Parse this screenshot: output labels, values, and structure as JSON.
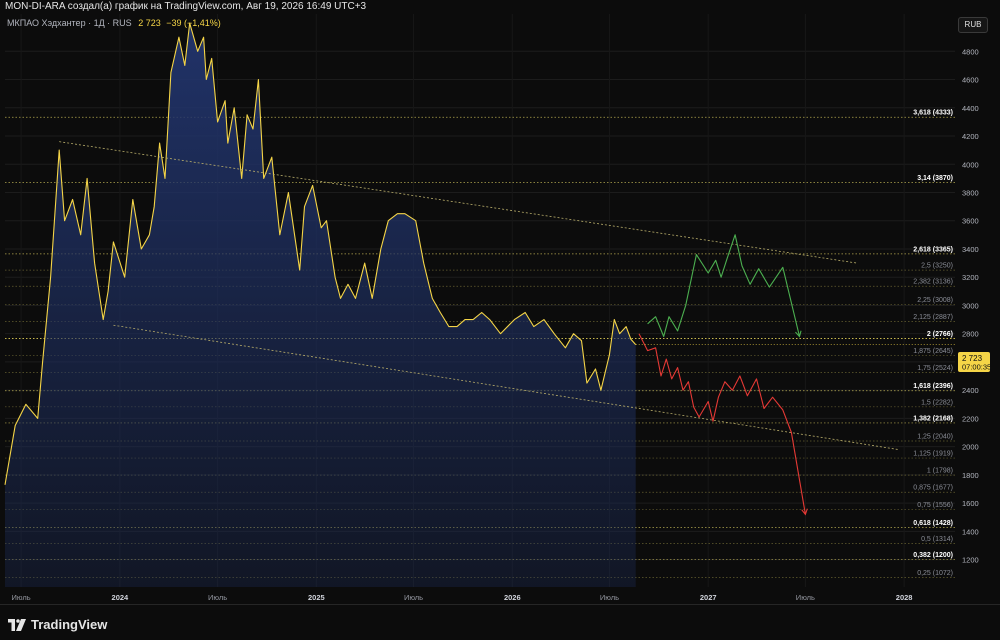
{
  "header": {
    "attribution": "MON-DI-ARA создал(а) график на TradingView.com, Авг 19, 2026 16:49 UTC+3"
  },
  "legend": {
    "symbol": "МКПАО Хэдхантер · 1Д · RUS",
    "price": "2 723",
    "change": "−39 (−1,41%)"
  },
  "currency_button": "RUB",
  "last_price_label": {
    "price": "2 723",
    "countdown": "07:00:35"
  },
  "footer": {
    "logo_text": "TradingView"
  },
  "colors": {
    "price_line": "#f5d547",
    "area_fill": "#1b2a55",
    "bullish_projection": "#4caf50",
    "bearish_projection": "#e53935",
    "fib_line": "#cfc25a",
    "channel_line": "#b8ad6a"
  },
  "chart_data": {
    "type": "area",
    "title": "МКПАО Хэдхантер",
    "x_ticks": [
      "Июль",
      "2024",
      "Июль",
      "2025",
      "Июль",
      "2026",
      "Июль",
      "2027",
      "Июль",
      "2028"
    ],
    "y_ticks": [
      1200,
      1400,
      1600,
      1800,
      2000,
      2200,
      2400,
      2600,
      2800,
      3000,
      3200,
      3400,
      3600,
      3800,
      4000,
      4200,
      4400,
      4600,
      4800
    ],
    "ylim": [
      1020,
      5050
    ],
    "grid": true,
    "fib_levels": [
      {
        "label": "3,618 (4333)",
        "value": 4333,
        "bold": true
      },
      {
        "label": "3,14 (3870)",
        "value": 3870,
        "bold": true
      },
      {
        "label": "2,618 (3365)",
        "value": 3365,
        "bold": true
      },
      {
        "label": "2,5 (3250)",
        "value": 3250,
        "bold": false
      },
      {
        "label": "2,382 (3136)",
        "value": 3136,
        "bold": false
      },
      {
        "label": "2,25 (3008)",
        "value": 3008,
        "bold": false
      },
      {
        "label": "2,125 (2887)",
        "value": 2887,
        "bold": false
      },
      {
        "label": "2 (2766)",
        "value": 2766,
        "bold": true,
        "highlight": true
      },
      {
        "label": "1,875 (2645)",
        "value": 2645,
        "bold": false
      },
      {
        "label": "1,75 (2524)",
        "value": 2524,
        "bold": false
      },
      {
        "label": "1,618 (2396)",
        "value": 2396,
        "bold": true
      },
      {
        "label": "1,5 (2282)",
        "value": 2282,
        "bold": false
      },
      {
        "label": "1,382 (2168)",
        "value": 2168,
        "bold": true
      },
      {
        "label": "1,25 (2040)",
        "value": 2040,
        "bold": false
      },
      {
        "label": "1,125 (1919)",
        "value": 1919,
        "bold": false
      },
      {
        "label": "1 (1798)",
        "value": 1798,
        "bold": false
      },
      {
        "label": "0,875 (1677)",
        "value": 1677,
        "bold": false
      },
      {
        "label": "0,75 (1556)",
        "value": 1556,
        "bold": false
      },
      {
        "label": "0,618 (1428)",
        "value": 1428,
        "bold": true
      },
      {
        "label": "0,5 (1314)",
        "value": 1314,
        "bold": false
      },
      {
        "label": "0,382 (1200)",
        "value": 1200,
        "bold": true
      },
      {
        "label": "0,25 (1072)",
        "value": 1072,
        "bold": false
      }
    ],
    "price_series": {
      "name": "МКПАО Хэдхантер",
      "x": [
        "2023-06-01",
        "2023-06-20",
        "2023-07-10",
        "2023-08-01",
        "2023-08-10",
        "2023-08-25",
        "2023-09-10",
        "2023-09-20",
        "2023-10-05",
        "2023-10-20",
        "2023-11-01",
        "2023-11-15",
        "2023-12-01",
        "2023-12-10",
        "2023-12-20",
        "2024-01-10",
        "2024-01-25",
        "2024-02-10",
        "2024-02-25",
        "2024-03-05",
        "2024-03-15",
        "2024-03-25",
        "2024-04-05",
        "2024-04-20",
        "2024-05-01",
        "2024-05-10",
        "2024-05-25",
        "2024-06-05",
        "2024-06-10",
        "2024-06-20",
        "2024-07-01",
        "2024-07-15",
        "2024-07-20",
        "2024-08-01",
        "2024-08-15",
        "2024-08-25",
        "2024-09-05",
        "2024-09-15",
        "2024-09-25",
        "2024-10-10",
        "2024-10-25",
        "2024-11-10",
        "2024-12-01",
        "2024-12-10",
        "2024-12-25",
        "2025-01-10",
        "2025-01-20",
        "2025-02-05",
        "2025-02-15",
        "2025-03-01",
        "2025-03-15",
        "2025-04-01",
        "2025-04-15",
        "2025-05-01",
        "2025-05-15",
        "2025-06-01",
        "2025-06-15",
        "2025-07-05",
        "2025-07-20",
        "2025-08-05",
        "2025-08-20",
        "2025-09-05",
        "2025-09-20",
        "2025-10-05",
        "2025-10-20",
        "2025-11-05",
        "2025-11-20",
        "2025-12-10",
        "2026-01-05",
        "2026-01-25",
        "2026-02-10",
        "2026-03-01",
        "2026-03-20",
        "2026-04-10",
        "2026-04-25",
        "2026-05-10",
        "2026-05-20",
        "2026-06-05",
        "2026-06-15",
        "2026-07-01",
        "2026-07-10",
        "2026-07-20",
        "2026-08-01",
        "2026-08-10",
        "2026-08-19"
      ],
      "y": [
        1730,
        2150,
        2300,
        2200,
        2600,
        3200,
        4100,
        3600,
        3750,
        3500,
        3900,
        3300,
        2900,
        3100,
        3450,
        3200,
        3750,
        3400,
        3500,
        3700,
        4150,
        3900,
        4650,
        4900,
        4700,
        5000,
        4800,
        4900,
        4600,
        4750,
        4300,
        4450,
        4150,
        4400,
        3900,
        4350,
        4250,
        4600,
        3900,
        4050,
        3500,
        3800,
        3250,
        3700,
        3850,
        3550,
        3600,
        3200,
        3050,
        3150,
        3050,
        3300,
        3050,
        3400,
        3600,
        3650,
        3650,
        3600,
        3300,
        3050,
        2950,
        2850,
        2850,
        2900,
        2900,
        2950,
        2900,
        2800,
        2900,
        2950,
        2850,
        2900,
        2800,
        2700,
        2800,
        2750,
        2450,
        2550,
        2400,
        2650,
        2900,
        2800,
        2850,
        2760,
        2723
      ]
    },
    "channel_lines": [
      {
        "name": "upper",
        "x": [
          "2023-09-10",
          "2027-10-05"
        ],
        "y": [
          4160,
          3300
        ]
      },
      {
        "name": "lower",
        "x": [
          "2023-12-20",
          "2027-12-20"
        ],
        "y": [
          2860,
          1980
        ]
      }
    ],
    "projections": [
      {
        "name": "bullish",
        "x": [
          "2026-09-10",
          "2026-09-25",
          "2026-10-10",
          "2026-10-20",
          "2026-11-05",
          "2026-11-20",
          "2026-12-10",
          "2027-01-01",
          "2027-01-15",
          "2027-01-25",
          "2027-02-05",
          "2027-02-20",
          "2027-03-05",
          "2027-03-20",
          "2027-04-05",
          "2027-04-25",
          "2027-05-20",
          "2027-06-20"
        ],
        "y": [
          2870,
          2920,
          2780,
          2920,
          2820,
          3000,
          3360,
          3230,
          3320,
          3200,
          3330,
          3500,
          3280,
          3150,
          3260,
          3130,
          3270,
          2780
        ]
      },
      {
        "name": "bearish",
        "x": [
          "2026-08-25",
          "2026-09-10",
          "2026-09-25",
          "2026-10-05",
          "2026-10-15",
          "2026-10-25",
          "2026-11-05",
          "2026-11-15",
          "2026-11-25",
          "2026-12-05",
          "2026-12-15",
          "2027-01-01",
          "2027-01-10",
          "2027-01-20",
          "2027-02-01",
          "2027-02-15",
          "2027-03-01",
          "2027-03-15",
          "2027-04-01",
          "2027-04-15",
          "2027-05-01",
          "2027-05-20",
          "2027-06-05",
          "2027-07-01"
        ],
        "y": [
          2800,
          2680,
          2700,
          2500,
          2620,
          2480,
          2560,
          2400,
          2460,
          2280,
          2210,
          2320,
          2180,
          2350,
          2460,
          2400,
          2500,
          2360,
          2480,
          2270,
          2350,
          2260,
          2100,
          1520
        ]
      }
    ]
  }
}
